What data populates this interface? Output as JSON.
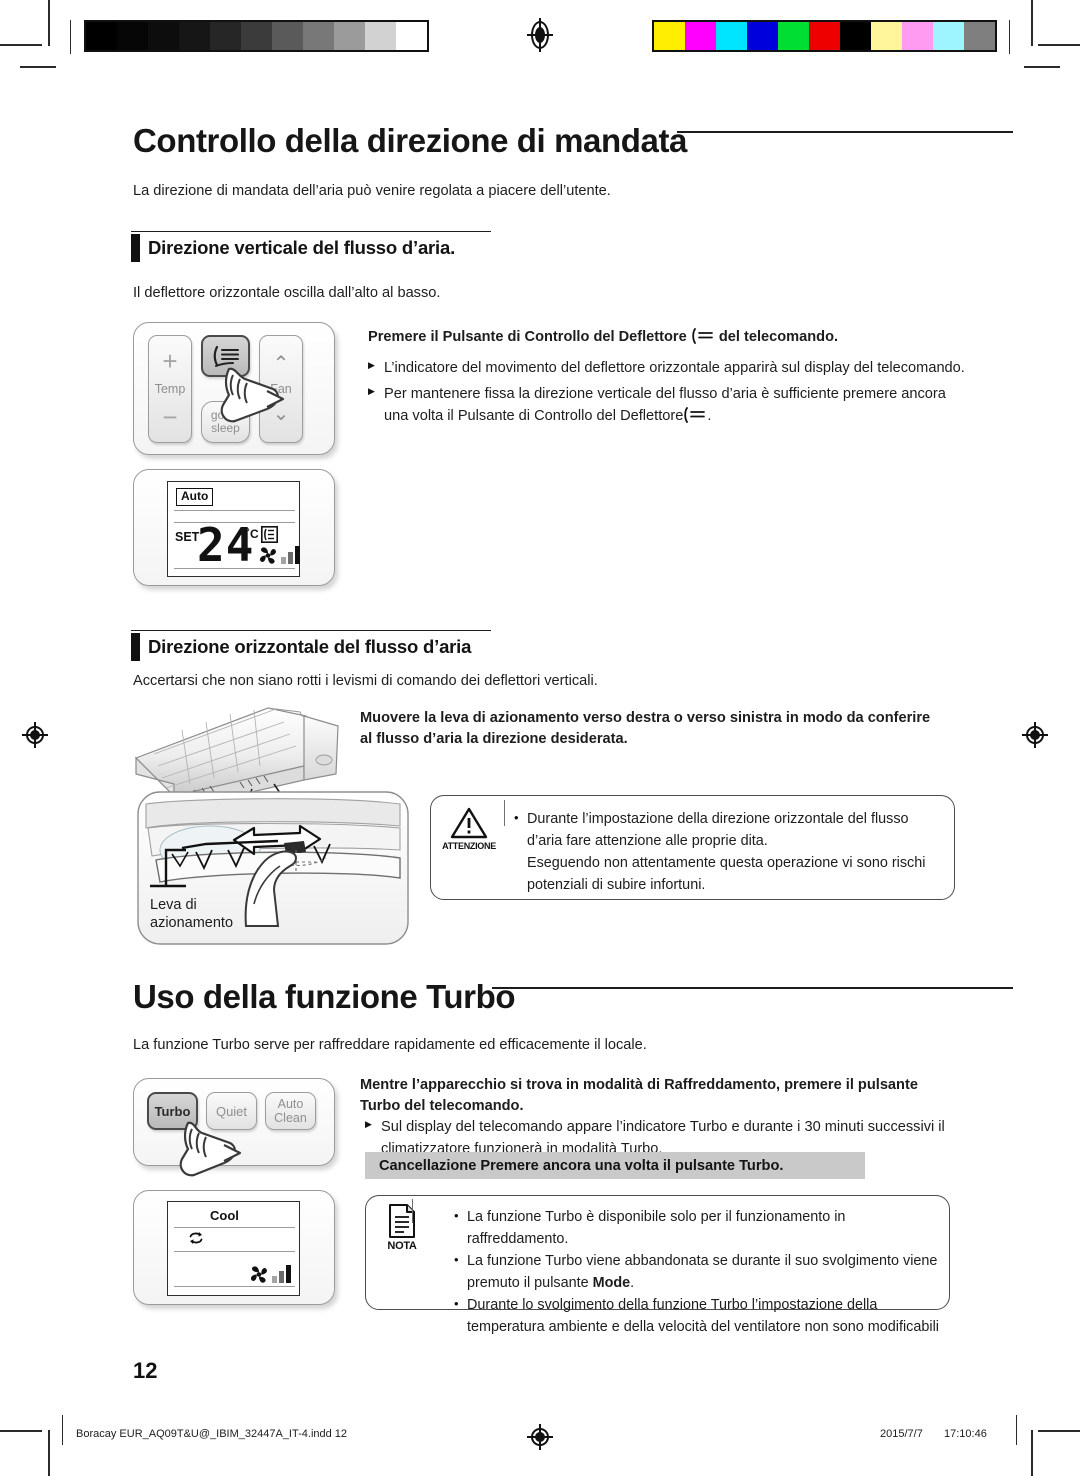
{
  "document": {
    "page_number": "12",
    "footer_left": "Boracay EUR_AQ09T&U@_IBIM_32447A_IT-4.indd   12",
    "footer_date": "2015/7/7",
    "footer_time": "17:10:46"
  },
  "calibration": {
    "grayscale": [
      "#000000",
      "#060606",
      "#0d0d0d",
      "#161616",
      "#262626",
      "#3b3b3b",
      "#5a5a5a",
      "#787878",
      "#9b9b9b",
      "#d2d2d2",
      "#ffffff"
    ],
    "colors": [
      "#ffee00",
      "#ff00ff",
      "#00e5ff",
      "#0000dd",
      "#00dd33",
      "#ee0000",
      "#000000",
      "#fff59a",
      "#ff9cf2",
      "#9ef4ff",
      "#7f7f7f"
    ]
  },
  "sections": {
    "airflow": {
      "title": "Controllo della direzione di mandata",
      "intro": "La direzione di mandata dell’aria può venire regolata a piacere dell’utente.",
      "vertical": {
        "heading": "Direzione verticale del flusso d’aria.",
        "lead": "Il deflettore orizzontale oscilla dall’alto al basso.",
        "instruction_pre": "Premere il Pulsante di Controllo del Deflettore",
        "instruction_post": "del telecomando.",
        "bullets": [
          "L’indicatore del movimento del deflettore orizzontale apparirà sul display del telecomando.",
          "Per mantenere fissa la direzione verticale  del flusso d’aria è sufficiente premere ancora una volta il Pulsante di Controllo del Deflettore"
        ],
        "remote": {
          "temp_label": "Temp",
          "plus": "+",
          "minus": "−",
          "deflector_key": "deflector-icon",
          "good_sleep_line1": "good’",
          "good_sleep_line2": "sleep",
          "fan_label": "Fan",
          "fan_up": "⌃",
          "fan_down": "⌄"
        },
        "display": {
          "mode_badge": "Auto",
          "set_label": "SET",
          "temperature": "24",
          "unit": "˚C",
          "swing_icon": "deflector-icon",
          "fan_icon": "fan-icon",
          "fan_level_bars": 3
        }
      },
      "horizontal": {
        "heading": "Direzione orizzontale del flusso d’aria",
        "lead": "Accertarsi che non siano rotti i levismi di comando dei deflettori verticali.",
        "instruction": "Muovere la leva di azionamento  verso destra o verso sinistra in modo da conferire al flusso d’aria la direzione desiderata.",
        "lever_label_line1": "Leva di",
        "lever_label_line2": "azionamento",
        "caution": {
          "icon_caption": "ATTENZIONE",
          "lines": [
            "Durante l’impostazione della direzione orizzontale del flusso d’aria fare attenzione alle proprie  dita.",
            "Eseguendo non attentamente questa operazione vi sono rischi potenziali di subire infortuni."
          ]
        }
      }
    },
    "turbo": {
      "title": "Uso  della funzione Turbo",
      "intro": "La funzione Turbo serve per raffreddare rapidamente ed efficacemente  il locale.",
      "instruction": "Mentre l’apparecchio  si trova in modalità di Raffreddamento, premere il pulsante Turbo del telecomando.",
      "bullets": [
        "Sul display del telecomando appare l’indicatore Turbo e durante i 30 minuti successivi  il climatizzatore funzionerà in modalità Turbo."
      ],
      "cancel_band": "Cancellazione    Premere ancora una volta il pulsante Turbo.",
      "remote": {
        "turbo": "Turbo",
        "quiet": "Quiet",
        "auto_clean_line1": "Auto",
        "auto_clean_line2": "Clean"
      },
      "display": {
        "mode": "Cool",
        "turbo_icon": "turbo-icon",
        "fan_icon": "fan-icon",
        "fan_level_bars": 3
      },
      "note": {
        "icon_caption": "NOTA",
        "items": [
          "La funzione Turbo è disponibile solo per il funzionamento in raffreddamento.",
          "La funzione Turbo viene abbandonata se durante il suo svolgimento viene premuto il pulsante Mode.",
          "Durante lo svolgimento della funzione Turbo l’impostazione della temperatura ambiente e della velocità del ventilatore non sono modificabili"
        ],
        "bold_word": "Mode"
      }
    }
  }
}
